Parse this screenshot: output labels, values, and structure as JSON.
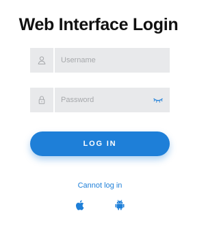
{
  "header": {
    "title": "Web Interface Login"
  },
  "form": {
    "username": {
      "placeholder": "Username",
      "value": "",
      "icon": "user-icon"
    },
    "password": {
      "placeholder": "Password",
      "value": "",
      "icon": "lock-icon",
      "toggle_icon": "eye-closed-icon"
    },
    "login_label": "LOG IN",
    "cant_login_label": "Cannot log in"
  },
  "apps": [
    {
      "icon": "apple-icon"
    },
    {
      "icon": "android-icon"
    }
  ],
  "colors": {
    "accent": "#1e7fd8",
    "field_bg": "#e8e9eb",
    "placeholder": "#a6a8ab",
    "title": "#111111"
  }
}
